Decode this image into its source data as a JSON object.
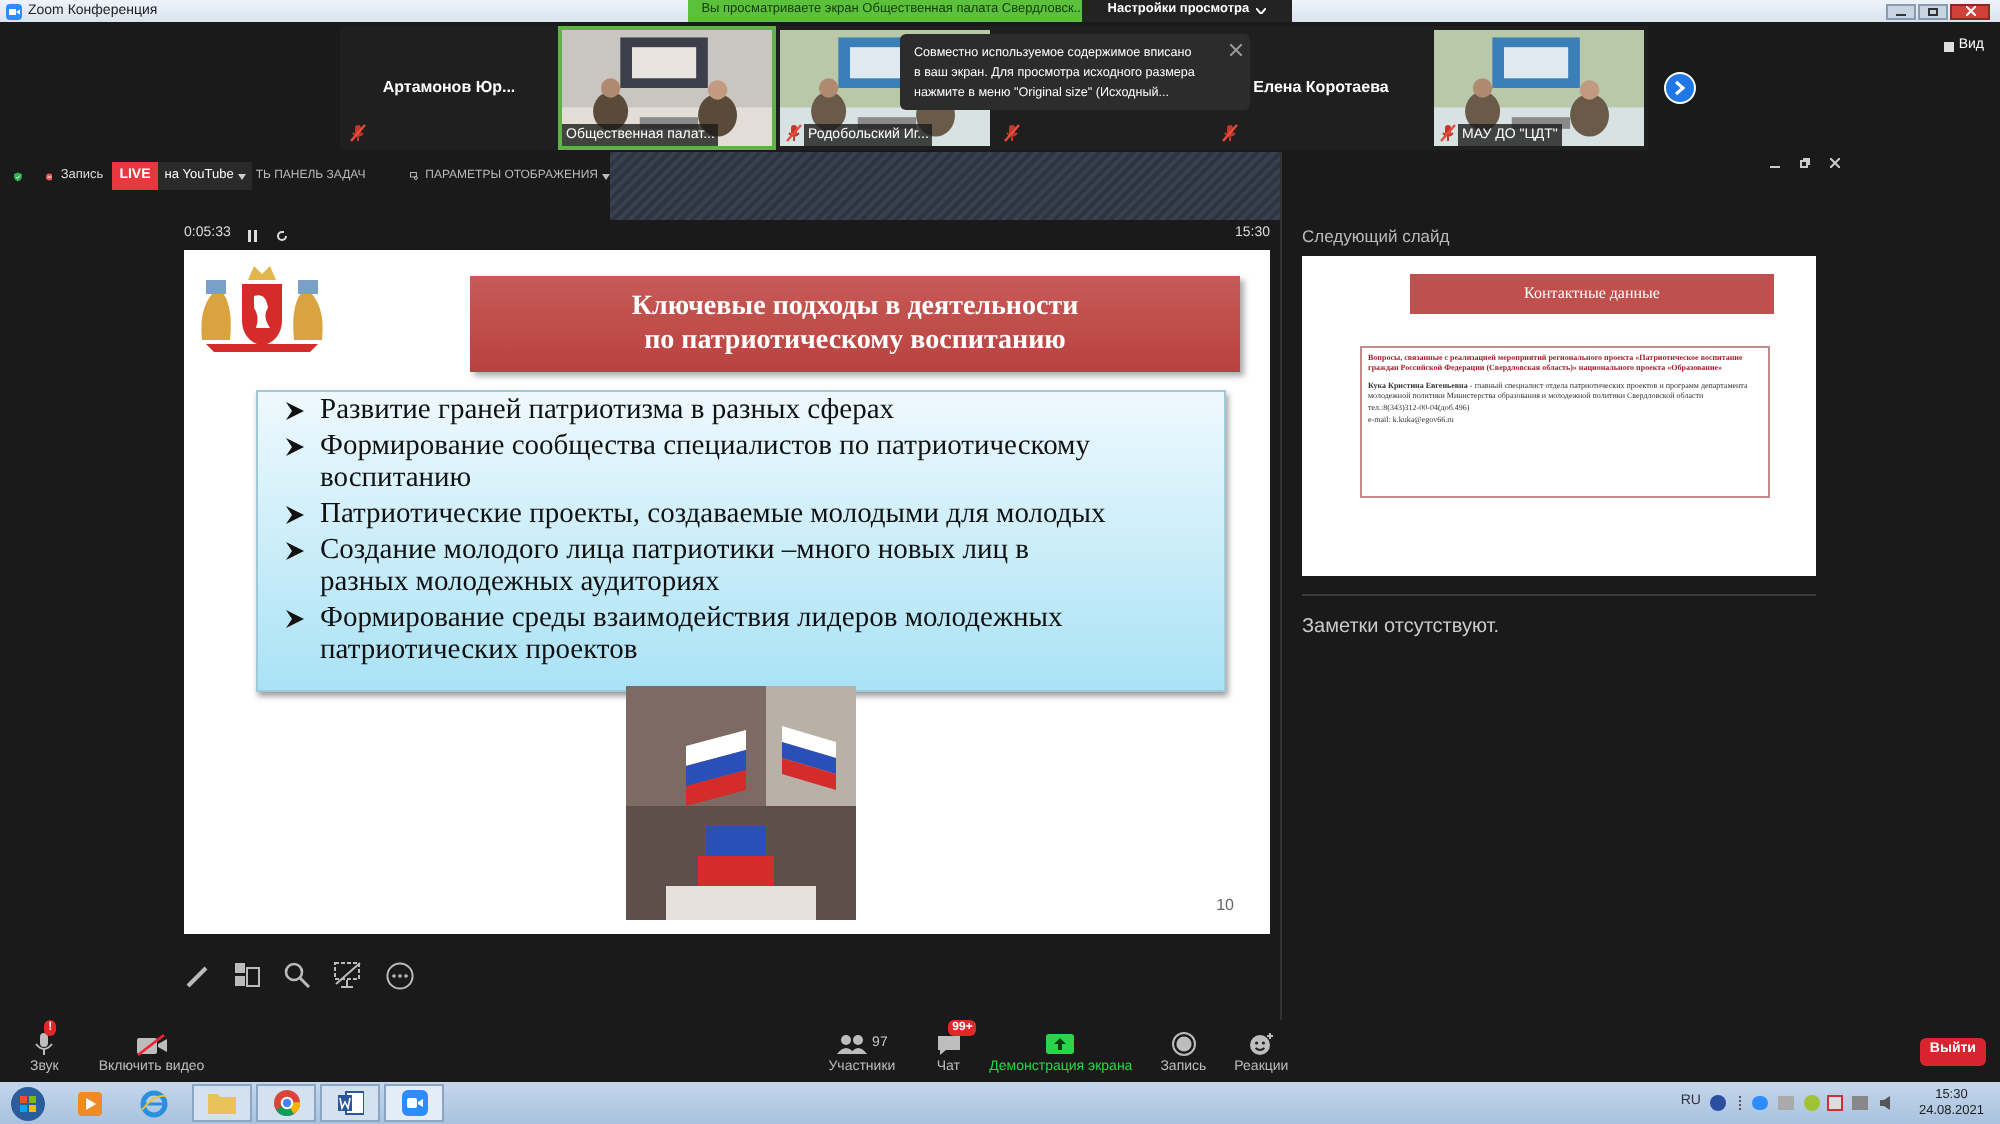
{
  "title_bar": {
    "title": "Zoom Конференция",
    "share_banner": "Вы просматриваете экран Общественная палата Свердловск...",
    "view_options": "Настройки просмотра"
  },
  "participants": [
    {
      "kind": "name",
      "name": "Артамонов Юр...",
      "muted": true,
      "active_speaker": false
    },
    {
      "kind": "video",
      "name": "Общественная палат...",
      "muted": false,
      "active_speaker": true
    },
    {
      "kind": "video",
      "name": "Родобольский Иг...",
      "muted": true,
      "active_speaker": false
    },
    {
      "kind": "covered",
      "muted": true,
      "active_speaker": false
    },
    {
      "kind": "name",
      "name": "Елена Коротаева",
      "muted": true,
      "active_speaker": false
    },
    {
      "kind": "video",
      "name": "МАУ ДО \"ЦДТ\"",
      "muted": true,
      "active_speaker": false
    }
  ],
  "view_button": "Вид",
  "tooltip": {
    "lines": [
      "Совместно используемое содержимое вписано",
      "в ваш экран. Для просмотра исходного размера",
      "нажмите в меню \"Original size\" (Исходный..."
    ]
  },
  "share_toolbar": {
    "record_label": "Запись",
    "live_badge": "LIVE",
    "stream_target": "на YouTube",
    "hide_taskbar": "ТЬ ПАНЕЛЬ ЗАДАЧ",
    "display_options": "ПАРАМЕТРЫ ОТОБРАЖЕНИЯ"
  },
  "presenter": {
    "elapsed": "0:05:33",
    "clock": "15:30",
    "next_slide_label": "Следующий слайд",
    "notes": "Заметки отсутствуют."
  },
  "slide": {
    "title_lines": [
      "Ключевые подходы в деятельности",
      "по патриотическому воспитанию"
    ],
    "bullets": [
      "Развитие граней патриотизма в разных сферах",
      "Формирование сообщества специалистов по патриотическому воспитанию",
      "Патриотические проекты, создаваемые молодыми для молодых",
      "Создание молодого лица патриотики –много новых лиц в разных молодежных аудиториях",
      "Формирование среды взаимодействия лидеров молодежных патриотических проектов"
    ],
    "page_number": "10"
  },
  "next_slide": {
    "title": "Контактные данные",
    "question": "Вопросы, связанные с реализацией мероприятий регионального проекта «Патриотическое воспитание граждан Российской Федерации (Свердловская область)» национального проекта «Образование»",
    "contact": "**Кука Кристина Евгеньевна** - главный специалист отдела патриотических проектов и программ департамента молодежной политики Министерства образования и молодежной политики Свердловской области",
    "phone": "тел.:8(343)312-00-04(доб.496)",
    "email": "e-mail: k.kuka@egov66.ru"
  },
  "meeting_controls": [
    {
      "kind": "audio",
      "label": "Звук",
      "badge": "!",
      "active": false
    },
    {
      "kind": "video",
      "label": "Включить видео",
      "active": false
    },
    {
      "kind": "participants",
      "label": "Участники",
      "count": "97",
      "active": false
    },
    {
      "kind": "chat",
      "label": "Чат",
      "badge": "99+",
      "active": false
    },
    {
      "kind": "share",
      "label": "Демонстрация экрана",
      "active": true
    },
    {
      "kind": "record",
      "label": "Запись",
      "active": false
    },
    {
      "kind": "reactions",
      "label": "Реакции",
      "active": false
    }
  ],
  "leave_button": "Выйти",
  "taskbar": {
    "language": "RU",
    "time": "15:30",
    "date": "24.08.2021"
  }
}
